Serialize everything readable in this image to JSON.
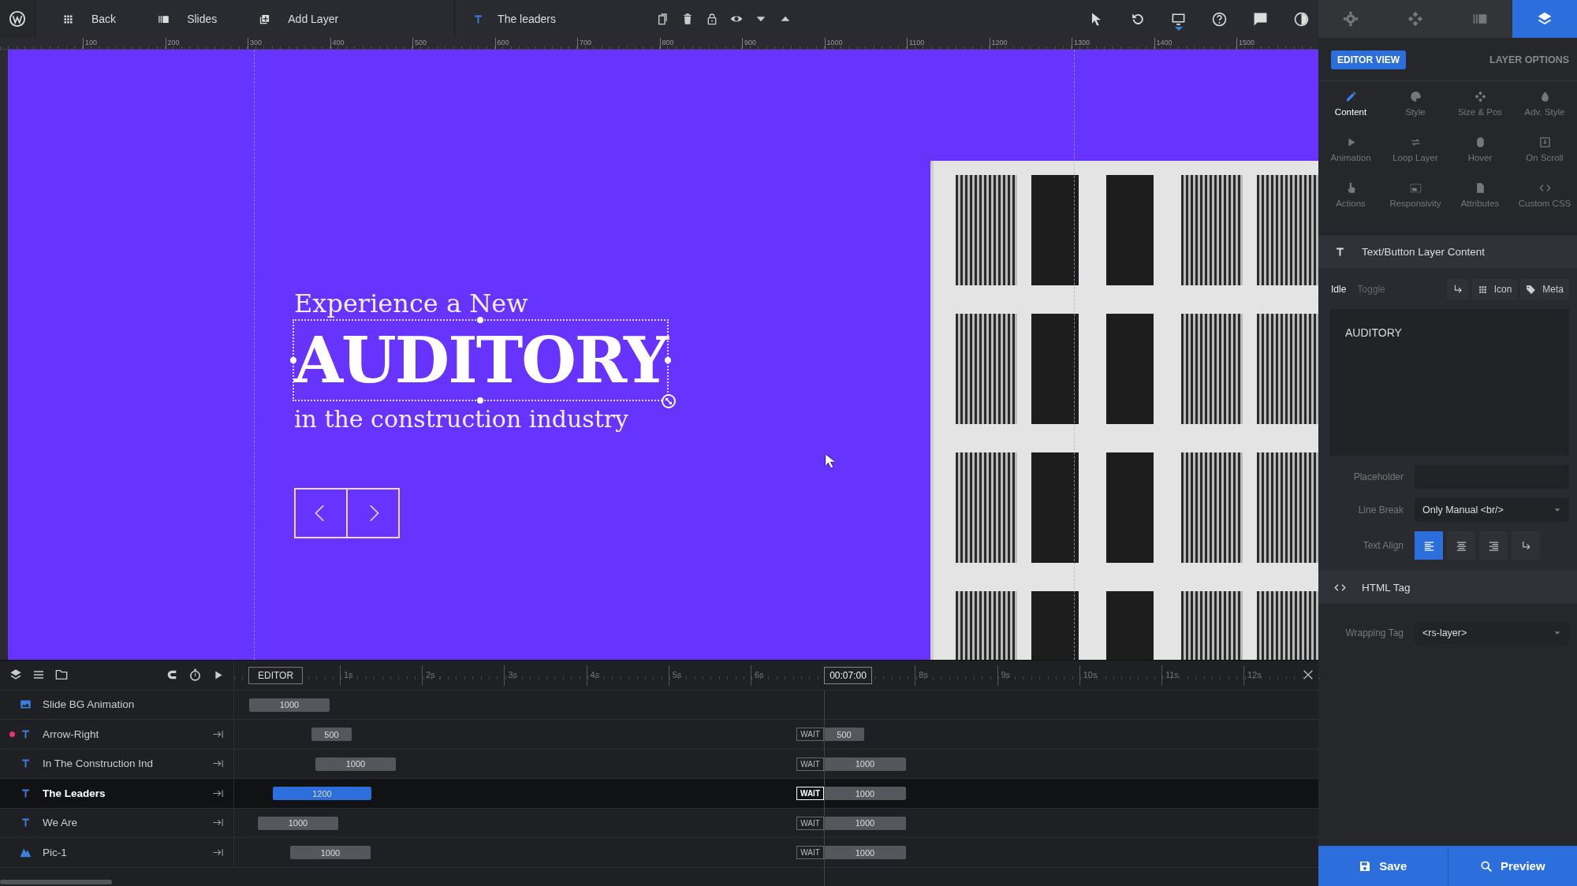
{
  "toolbar": {
    "buttons": [
      {
        "label": "Back",
        "kind": "grid"
      },
      {
        "label": "Slides",
        "kind": "slides"
      },
      {
        "label": "Add Layer",
        "kind": "add"
      }
    ],
    "layer_name": "The leaders",
    "layer_tools": [
      {
        "kind": "copy"
      },
      {
        "kind": "trash"
      },
      {
        "kind": "lock"
      },
      {
        "kind": "eye"
      },
      {
        "kind": "caretdown"
      },
      {
        "kind": "caretup"
      }
    ],
    "view_tools": [
      {
        "kind": "pointer",
        "selected": false
      },
      {
        "kind": "undo",
        "selected": false
      },
      {
        "kind": "desktop",
        "selected": true
      },
      {
        "kind": "help",
        "selected": false
      },
      {
        "kind": "comment",
        "selected": false
      },
      {
        "kind": "contrast",
        "selected": false
      }
    ]
  },
  "panel_tabs": [
    {
      "kind": "gear",
      "selected": false
    },
    {
      "kind": "move",
      "selected": false
    },
    {
      "kind": "library",
      "selected": false
    },
    {
      "kind": "layers",
      "selected": true
    }
  ],
  "ruler": {
    "labels": [
      "100",
      "200",
      "300",
      "400",
      "500",
      "600",
      "700",
      "800",
      "900",
      "1000",
      "1100",
      "1200",
      "1300",
      "1400",
      "1500"
    ]
  },
  "canvas": {
    "heading": "Experience a New",
    "title": {
      "text": "AUDITORY",
      "selected": true
    },
    "subtitle": "in the construction industry"
  },
  "timeline": {
    "mode": "EDITOR",
    "time": "00:07:00",
    "ticks": [
      "1s",
      "2s",
      "3s",
      "4s",
      "5s",
      "6s",
      "8s",
      "9s",
      "10s",
      "11s",
      "12s"
    ],
    "layers": [
      {
        "name": "Slide BG Animation",
        "kind": "background",
        "selected": false,
        "flagged": false,
        "duration": "1000"
      },
      {
        "name": "Arrow-Right",
        "kind": "text",
        "selected": false,
        "flagged": true,
        "duration": "500",
        "wait": "WAIT",
        "out_duration": "500"
      },
      {
        "name": "In The Construction Ind",
        "kind": "text",
        "selected": false,
        "flagged": false,
        "duration": "1000",
        "wait": "WAIT",
        "out_duration": "1000"
      },
      {
        "name": "The Leaders",
        "kind": "text",
        "selected": true,
        "flagged": false,
        "duration": "1200",
        "wait": "WAIT",
        "out_duration": "1000"
      },
      {
        "name": "We Are",
        "kind": "text",
        "selected": false,
        "flagged": false,
        "duration": "1000",
        "wait": "WAIT",
        "out_duration": "1000"
      },
      {
        "name": "Pic-1",
        "kind": "image",
        "selected": false,
        "flagged": false,
        "duration": "1000",
        "wait": "WAIT",
        "out_duration": "1000"
      }
    ]
  },
  "panel": {
    "view_button": "EDITOR VIEW",
    "options_title": "LAYER OPTIONS",
    "categories": [
      {
        "label": "Content",
        "kind": "pencil",
        "selected": true
      },
      {
        "label": "Style",
        "kind": "palette",
        "selected": false
      },
      {
        "label": "Size & Pos",
        "kind": "move",
        "selected": false
      },
      {
        "label": "Adv. Style",
        "kind": "drop",
        "selected": false
      },
      {
        "label": "Animation",
        "kind": "play",
        "selected": false
      },
      {
        "label": "Loop Layer",
        "kind": "loop",
        "selected": false
      },
      {
        "label": "Hover",
        "kind": "mouse",
        "selected": false
      },
      {
        "label": "On Scroll",
        "kind": "download",
        "selected": false
      },
      {
        "label": "Actions",
        "kind": "hand",
        "selected": false
      },
      {
        "label": "Responsivity",
        "kind": "responsive",
        "selected": false
      },
      {
        "label": "Attributes",
        "kind": "doc",
        "selected": false
      },
      {
        "label": "Custom CSS",
        "kind": "code",
        "selected": false
      }
    ],
    "content_section": {
      "title": "Text/Button Layer Content",
      "tabs": [
        {
          "label": "Idle",
          "selected": true
        },
        {
          "label": "Toggle",
          "selected": false
        }
      ],
      "buttons": [
        {
          "label": "Icon",
          "kind": "dots"
        },
        {
          "label": "Meta",
          "kind": "tag"
        }
      ],
      "text": "AUDITORY",
      "fields": [
        {
          "label": "Placeholder",
          "kind": "input"
        },
        {
          "label": "Line Break",
          "kind": "select",
          "value": "Only Manual <br/>"
        },
        {
          "label": "Text Align",
          "kind": "align",
          "options": [
            {
              "kind": "alleft",
              "selected": true
            },
            {
              "kind": "alcenter",
              "selected": false
            },
            {
              "kind": "alright",
              "selected": false
            },
            {
              "kind": "ret",
              "selected": false
            }
          ]
        }
      ]
    },
    "html_section": {
      "title": "HTML Tag",
      "fields": [
        {
          "label": "Wrapping Tag",
          "kind": "select",
          "value": "<rs-layer>"
        }
      ]
    },
    "actions": [
      {
        "label": "Save",
        "kind": "save"
      },
      {
        "label": "Preview",
        "kind": "search"
      }
    ]
  }
}
